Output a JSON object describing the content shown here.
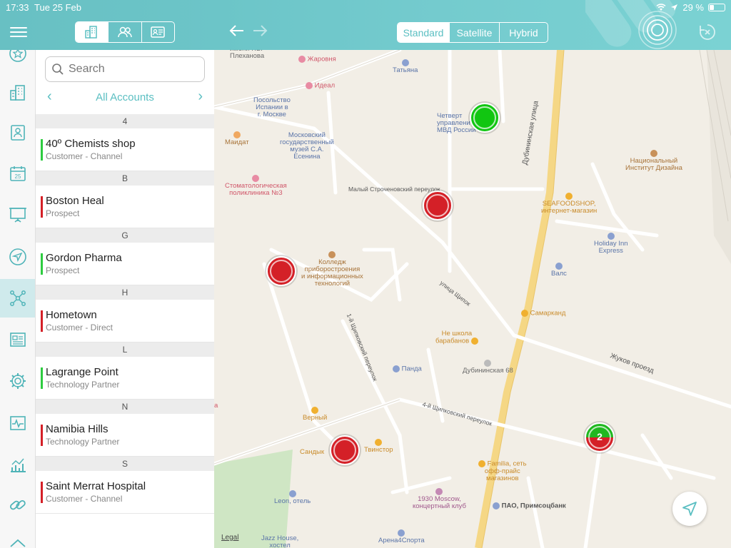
{
  "status": {
    "time": "17:33",
    "date": "Tue 25 Feb",
    "battery": "29 %"
  },
  "header": {
    "map_modes": [
      "Standard",
      "Satellite",
      "Hybrid"
    ],
    "active_map_mode": "Standard"
  },
  "accounts": {
    "search_placeholder": "Search",
    "title": "All Accounts",
    "sections": [
      {
        "letter": "4",
        "items": [
          {
            "name": "40º Chemists shop",
            "type": "Customer - Channel",
            "color": "#2ecc40"
          }
        ]
      },
      {
        "letter": "B",
        "items": [
          {
            "name": "Boston Heal",
            "type": "Prospect",
            "color": "#d42027"
          }
        ]
      },
      {
        "letter": "G",
        "items": [
          {
            "name": "Gordon Pharma",
            "type": "Prospect",
            "color": "#2ecc40"
          }
        ]
      },
      {
        "letter": "H",
        "items": [
          {
            "name": "Hometown",
            "type": "Customer - Direct",
            "color": "#d42027"
          }
        ]
      },
      {
        "letter": "L",
        "items": [
          {
            "name": "Lagrange Point",
            "type": "Technology Partner",
            "color": "#2ecc40"
          }
        ]
      },
      {
        "letter": "N",
        "items": [
          {
            "name": "Namibia Hills",
            "type": "Technology Partner",
            "color": "#d42027"
          }
        ]
      },
      {
        "letter": "S",
        "items": [
          {
            "name": "Saint Merrat Hospital",
            "type": "Customer - Channel",
            "color": "#d42027"
          }
        ]
      }
    ]
  },
  "map": {
    "cluster_count": "2",
    "legal": "Legal",
    "streets": {
      "dubininskaya": "Дубининская улица",
      "zhukov": "Жуков проезд",
      "malyi": "Малый Строченовский переулок",
      "shipok": "улица Щипок",
      "shipkov1": "1-й Щипковский переулок",
      "shipkov4": "4-й Щипковский переулок"
    },
    "pois": {
      "plekhanova": "имени Г.В.\nПлеханова",
      "zharovnya": "Жаровня",
      "tatyana": "Татьяна",
      "ideal": "Идеал",
      "spain_embassy": "Посольство\nИспании в\nг. Москве",
      "maidat": "Маидат",
      "esenin_museum": "Московский\nгосударственный\nмузей С.А.\nЕсенина",
      "mvd": "Четверт\nуправлени\nМВД России",
      "design_inst": "Национальный\nИнститут Дизайна",
      "stomat": "Стоматологическая\nполиклиника №3",
      "seafood": "SEAFOODSHOP,\nинтернет-магазин",
      "holiday_inn": "Holiday Inn\nExpress",
      "college": "Колледж\nприборостроения\nи информационных\nтехнологий",
      "vals": "Валс",
      "samarkand": "Самарканд",
      "ne_shkola": "Не школа\nбарабанов",
      "dub68": "Дубининская 68",
      "panda": "Панда",
      "vernyi": "Верный",
      "sandyk": "Сандык",
      "tvinstor": "Твинстор",
      "familia": "Familia, сеть\nофф-прайс\nмагазинов",
      "moscow1930": "1930 Moscow,\nконцертный клуб",
      "primsots": "ПАО, Примсоцбанк",
      "leon": "Leon, отель",
      "jazz": "Jazz House,\nхостел",
      "arena": "Арена4Спорта",
      "edge_a": "а"
    }
  }
}
